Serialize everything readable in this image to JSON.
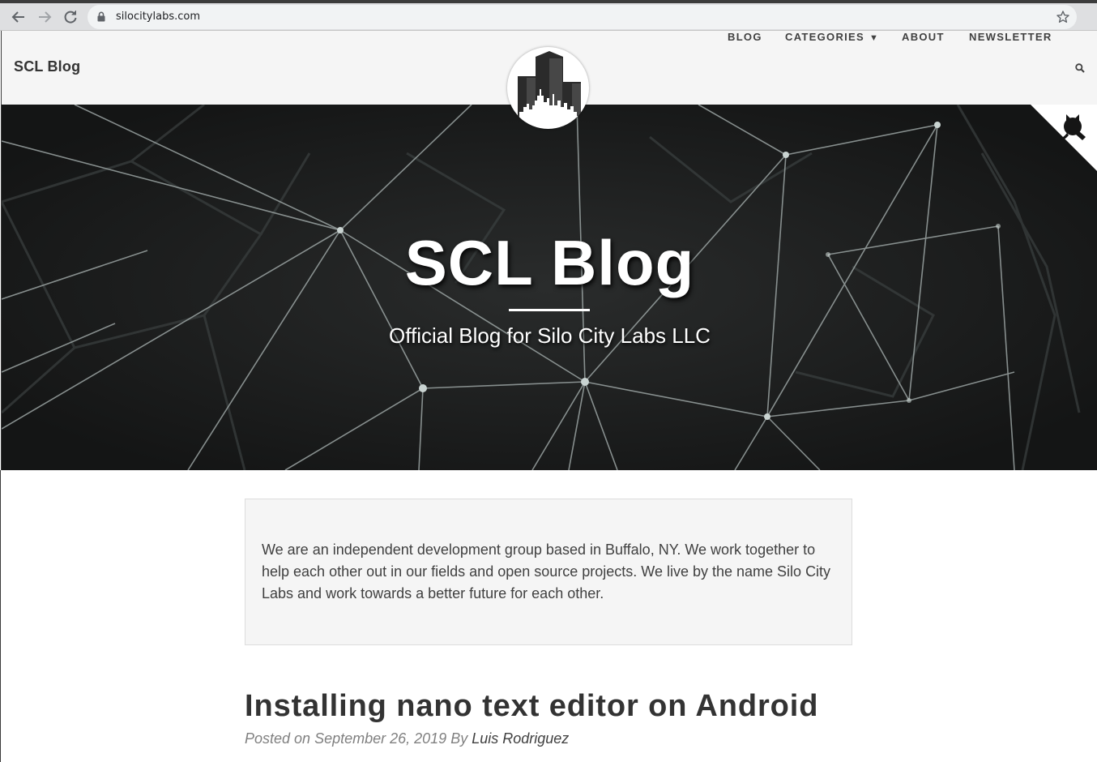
{
  "browser": {
    "url": "silocitylabs.com"
  },
  "site": {
    "brand": "SCL Blog",
    "nav": {
      "blog": "BLOG",
      "categories": "CATEGORIES",
      "categories_caret": "▼",
      "about": "ABOUT",
      "newsletter": "NEWSLETTER"
    }
  },
  "hero": {
    "title": "SCL Blog",
    "subtitle": "Official Blog for Silo City Labs LLC"
  },
  "intro": {
    "text": "We are an independent development group based in Buffalo, NY. We work together to help each other out in our fields and open source projects. We live by the name Silo City Labs and work towards a better future for each other."
  },
  "post": {
    "title": "Installing nano text editor on Android",
    "posted_prefix": "Posted on ",
    "date": "September 26, 2019",
    "by": " By ",
    "author": "Luis Rodriguez"
  },
  "icons": {
    "back": "arrow-left-icon",
    "forward": "arrow-right-icon",
    "reload": "reload-icon",
    "lock": "lock-icon",
    "bookmark": "star-icon",
    "search": "search-icon",
    "github": "github-octocat-icon"
  },
  "colors": {
    "navbar_bg": "#f5f5f5",
    "hero_bg": "#1b1c1c",
    "intro_bg": "#f5f5f5",
    "text": "#404040",
    "meta": "#808080"
  }
}
